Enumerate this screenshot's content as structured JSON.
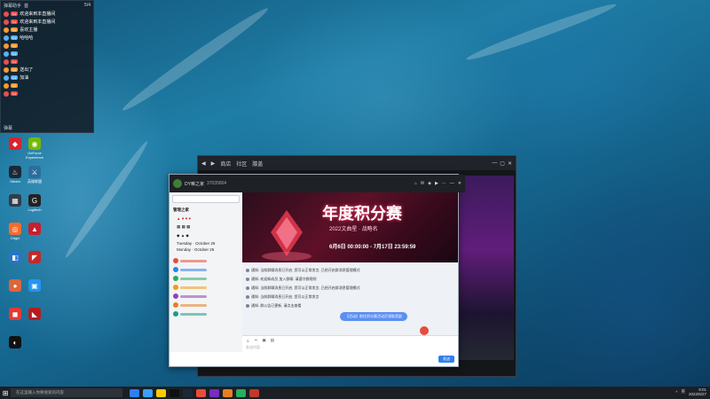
{
  "chat_overlay": {
    "header_left": "弹幕助手",
    "header_mid": "首",
    "header_right": "5/4",
    "messages": [
      {
        "color": "#e94f4f",
        "user": "",
        "text": "欢迎来到本直播间"
      },
      {
        "color": "#e94f4f",
        "user": "",
        "text": "欢迎来到本直播间"
      },
      {
        "color": "#ff9a2e",
        "user": "",
        "text": "喜欢主播"
      },
      {
        "color": "#5bb0ff",
        "user": "",
        "text": "哈哈哈"
      },
      {
        "color": "#ff9a2e",
        "user": "",
        "text": ""
      },
      {
        "color": "#5bb0ff",
        "user": "",
        "text": ""
      },
      {
        "color": "#e94f4f",
        "user": "",
        "text": ""
      },
      {
        "color": "#ff9a2e",
        "user": "",
        "text": "送出了"
      },
      {
        "color": "#5bb0ff",
        "user": "",
        "text": "加油"
      },
      {
        "color": "#ff9a2e",
        "user": "",
        "text": ""
      },
      {
        "color": "#e94f4f",
        "user": "",
        "text": ""
      }
    ],
    "footer": "弹幕"
  },
  "desktop_icons": [
    {
      "label": "",
      "color": "#d9232e",
      "glyph": "◆"
    },
    {
      "label": "GeForce Experience",
      "color": "#76b900",
      "glyph": "◉"
    },
    {
      "label": "Steam",
      "color": "#1b2838",
      "glyph": "♨"
    },
    {
      "label": "英雄联盟",
      "color": "#2d6d9c",
      "glyph": "⚔"
    },
    {
      "label": "",
      "color": "#333c48",
      "glyph": "▦"
    },
    {
      "label": "Logitech",
      "color": "#222",
      "glyph": "G"
    },
    {
      "label": "Origin",
      "color": "#f56c2d",
      "glyph": "◎"
    },
    {
      "label": "",
      "color": "#c71f2f",
      "glyph": "▲"
    },
    {
      "label": "",
      "color": "#2a73c9",
      "glyph": "◧"
    },
    {
      "label": "",
      "color": "#c62828",
      "glyph": "◤"
    },
    {
      "label": "",
      "color": "#e0643a",
      "glyph": "●"
    },
    {
      "label": "",
      "color": "#2196f3",
      "glyph": "▣"
    },
    {
      "label": "",
      "color": "#e53935",
      "glyph": "◼"
    },
    {
      "label": "",
      "color": "#b71c1c",
      "glyph": "◣"
    },
    {
      "label": "",
      "color": "#111",
      "glyph": "◐"
    }
  ],
  "browser": {
    "tabs": [
      "商店",
      "社区",
      "膝盖"
    ],
    "bottom_label": ""
  },
  "qq": {
    "title": "DY嘛之家",
    "group_id": "37035804",
    "search_placeholder": "",
    "group_label": "管理之家",
    "members_header": "",
    "member_line1": "Tuesday · October 26",
    "member_line2": "Monday · October 26",
    "banner_title": "年度积分赛",
    "banner_sub": "2022文曲星 · 战略名",
    "banner_dates": "6月6日 00:00:00 - 7月17日 23:59:59",
    "sys_msgs": [
      "通知: 当前群聊消息已开启, 您可以正常发言, 已经开启群消息管理模式",
      "通知: 欢迎新成员 加入群聊, 请遵守群规则",
      "通知: 当前群聊消息已开启, 您可以正常发言, 已经开启群消息管理模式",
      "通知: 当前群聊消息已开启, 您可以正常发言",
      "通知: 群公告已更新, 请点击查看"
    ],
    "bubble_text": "【活动】前往积分赛活动页领取奖励",
    "input_placeholder": "发送内容…",
    "send_label": "发送"
  },
  "taskbar": {
    "search_placeholder": "在这里输入你要搜索的内容",
    "tray_text": "英",
    "time": "9:01",
    "date": "2022/6/27"
  }
}
